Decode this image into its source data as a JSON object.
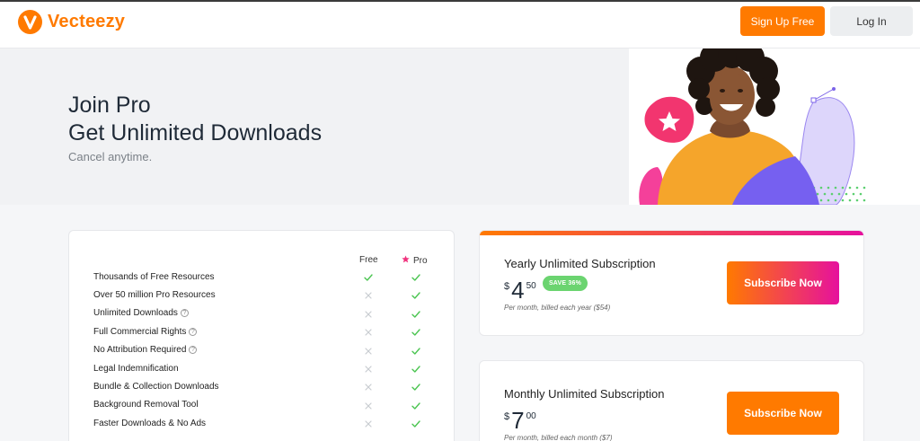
{
  "header": {
    "logo_text": "Vecteezy",
    "signup_label": "Sign Up Free",
    "login_label": "Log In"
  },
  "hero": {
    "title_line1": "Join Pro",
    "title_line2": "Get Unlimited Downloads",
    "subtitle": "Cancel anytime."
  },
  "features": {
    "col_free": "Free",
    "col_pro": "Pro",
    "rows": [
      {
        "label": "Thousands of Free Resources",
        "help": false,
        "free": true,
        "pro": true
      },
      {
        "label": "Over 50 million Pro Resources",
        "help": false,
        "free": false,
        "pro": true
      },
      {
        "label": "Unlimited Downloads",
        "help": true,
        "free": false,
        "pro": true
      },
      {
        "label": "Full Commercial Rights",
        "help": true,
        "free": false,
        "pro": true
      },
      {
        "label": "No Attribution Required",
        "help": true,
        "free": false,
        "pro": true
      },
      {
        "label": "Legal Indemnification",
        "help": false,
        "free": false,
        "pro": true
      },
      {
        "label": "Bundle & Collection Downloads",
        "help": false,
        "free": false,
        "pro": true
      },
      {
        "label": "Background Removal Tool",
        "help": false,
        "free": false,
        "pro": true
      },
      {
        "label": "Faster Downloads & No Ads",
        "help": false,
        "free": false,
        "pro": true
      }
    ]
  },
  "yearly": {
    "title": "Yearly Unlimited Subscription",
    "currency": "$",
    "price_whole": "4",
    "price_cents": "50",
    "badge": "SAVE 36%",
    "billing": "Per month, billed each year ($54)",
    "button": "Subscribe Now"
  },
  "monthly": {
    "title": "Monthly Unlimited Subscription",
    "currency": "$",
    "price_whole": "7",
    "price_cents": "00",
    "billing": "Per month, billed each month ($7)",
    "button": "Subscribe Now"
  },
  "colors": {
    "brand_orange": "#ff7a00",
    "brand_magenta": "#e6119d",
    "check_green": "#4cc552",
    "cross_gray": "#c8ccd1"
  }
}
